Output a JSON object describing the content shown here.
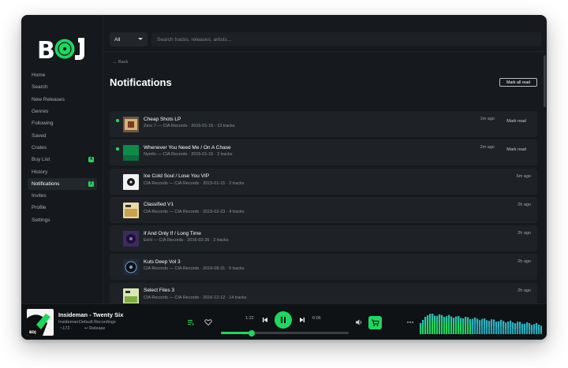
{
  "colors": {
    "accent": "#1ed760",
    "window_bg": "#16191d",
    "card_bg": "#1e2226"
  },
  "window": {
    "controls": [
      "close",
      "minimize",
      "maximize"
    ]
  },
  "brand": {
    "logo_text": "BDJ"
  },
  "sidebar": {
    "items": [
      {
        "label": "Home"
      },
      {
        "label": "Search"
      },
      {
        "label": "New Releases"
      },
      {
        "label": "Genres"
      },
      {
        "label": "Following"
      },
      {
        "label": "Saved"
      },
      {
        "label": "Crates"
      },
      {
        "label": "Buy List",
        "badge": "4"
      },
      {
        "label": "History"
      },
      {
        "label": "Notifications",
        "badge": "2",
        "active": true
      },
      {
        "label": "Invites"
      },
      {
        "label": "Profile"
      },
      {
        "label": "Settings"
      }
    ]
  },
  "search": {
    "filter_value": "All",
    "placeholder": "Search tracks, releases, artists..."
  },
  "page": {
    "back_label": "← Back",
    "title": "Notifications",
    "mark_all_label": "Mark all read"
  },
  "notifications": [
    {
      "title": "Cheap Shots LP",
      "subtitle": "Zero 7 — CIA Records · 2015-01-15 · 13 tracks",
      "time": "1m ago",
      "unread": true,
      "mark_label": "Mark read"
    },
    {
      "title": "Whenever You Need Me / On A Chase",
      "subtitle": "Nymfo — CIA Records · 2015-01-15 · 2 tracks",
      "time": "2m ago",
      "unread": true,
      "mark_label": "Mark read"
    },
    {
      "title": "Ice Cold Soul / Lose You VIP",
      "subtitle": "CIA Records — CIA Records · 2015-01-15 · 2 tracks",
      "time": "6m ago",
      "unread": false
    },
    {
      "title": "Classified V1",
      "subtitle": "CIA Records — CIA Records · 2015-02-23 · 4 tracks",
      "time": "2h ago",
      "unread": false
    },
    {
      "title": "If And Only If / Long Time",
      "subtitle": "Ed:it — CIA Records · 2016-02-26 · 2 tracks",
      "time": "2h ago",
      "unread": false
    },
    {
      "title": "Kuts Deep Vol 3",
      "subtitle": "CIA Records — CIA Records · 2016-08-31 · 5 tracks",
      "time": "2h ago",
      "unread": false
    },
    {
      "title": "Select Files 3",
      "subtitle": "CIA Records — CIA Records · 2016-12-12 · 14 tracks",
      "time": "2h ago",
      "unread": false
    }
  ],
  "player": {
    "title": "Insideman - Twenty Six",
    "artist": "Insideman",
    "label": "Default Recordings",
    "bpm": "~172 ·",
    "release_link": "↩ Release",
    "elapsed": "1:22",
    "duration": "6:06",
    "progress": 0.24,
    "icons": [
      "queue-icon",
      "heart-icon",
      "previous-icon",
      "pause-icon",
      "next-icon",
      "volume-icon",
      "cart-icon",
      "more-icon"
    ]
  }
}
